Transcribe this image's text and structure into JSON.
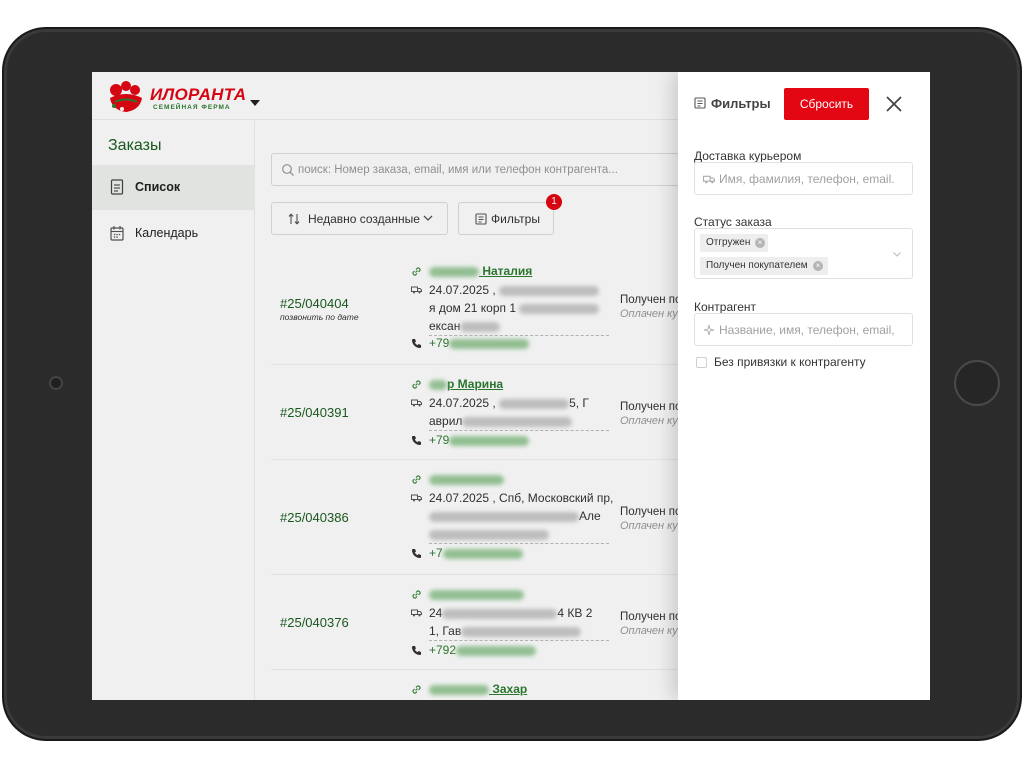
{
  "brand": {
    "name": "ИЛОРАНТА",
    "tagline": "СЕМЕЙНАЯ ФЕРМА"
  },
  "sidebar": {
    "title": "Заказы",
    "items": [
      {
        "label": "Список",
        "icon": "document-list-icon"
      },
      {
        "label": "Календарь",
        "icon": "calendar-icon"
      }
    ]
  },
  "search": {
    "placeholder": "поиск: Номер заказа, email, имя или телефон контрагента..."
  },
  "toolbar": {
    "sort_label": "Недавно созданные",
    "filter_label": "Фильтры",
    "filter_badge": "1"
  },
  "orders": [
    {
      "number": "#25/040404",
      "note": "позвонить по дате",
      "client_name": "Наталия",
      "date": "24.07.2025 ,",
      "addr_tail": "я дом 21 корп 1",
      "addr_tail2": "ексан",
      "phone": "+79",
      "status": "Получен по",
      "payment": "Оплачен ку"
    },
    {
      "number": "#25/040391",
      "note": "",
      "client_name": "р Марина",
      "date": "24.07.2025 ,",
      "addr_tail": "5, Г",
      "addr_tail2": "аврил",
      "phone": "+79",
      "status": "Получен по",
      "payment": "Оплачен ку"
    },
    {
      "number": "#25/040386",
      "note": "",
      "client_name": "",
      "date": "24.07.2025 , Спб, Московский пр,",
      "addr_tail": "Але",
      "addr_tail2": "",
      "phone": "+7",
      "status": "Получен по",
      "payment": "Оплачен ку"
    },
    {
      "number": "#25/040376",
      "note": "",
      "client_name": "",
      "date": "24",
      "addr_tail": "4 КВ 2",
      "addr_tail2": "1, Гав",
      "phone": "+792",
      "status": "Получен по",
      "payment": "Оплачен ку"
    },
    {
      "number": "",
      "note": "",
      "client_name": "Захар",
      "date": "",
      "addr_tail": "",
      "addr_tail2": "",
      "phone": "",
      "status": "",
      "payment": ""
    }
  ],
  "drawer": {
    "title": "Фильтры",
    "reset_label": "Сбросить",
    "courier_label": "Доставка курьером",
    "courier_placeholder": "Имя, фамилия, телефон, email.",
    "status_label": "Статус заказа",
    "status_tags": [
      "Отгружен",
      "Получен покупателем"
    ],
    "contractor_label": "Контрагент",
    "contractor_placeholder": "Название, имя, телефон, email,",
    "no_contractor_label": "Без привязки к контрагенту"
  },
  "colors": {
    "accent": "#e30613",
    "brand_green": "#1b5e20",
    "link_green": "#2e7d32"
  }
}
